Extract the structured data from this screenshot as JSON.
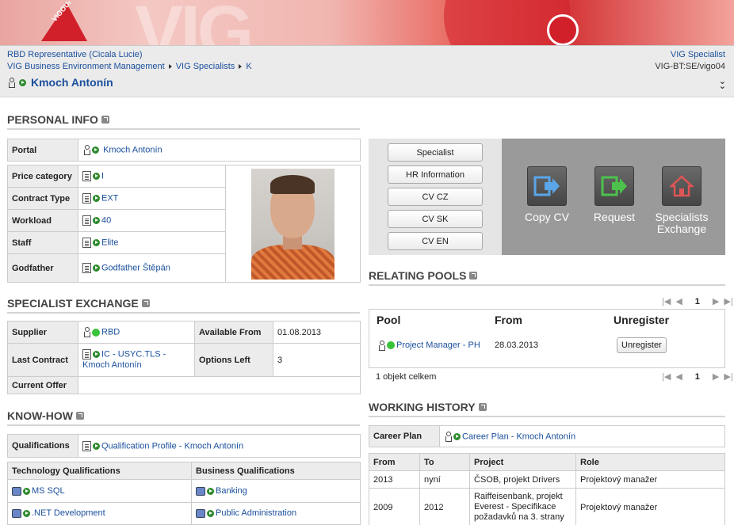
{
  "banner": {
    "logo_text": "VIGOUR",
    "ghost_text": "VIG"
  },
  "header": {
    "user": "RBD Representative (Cicala Lucie)",
    "breadcrumb": [
      "VIG Business Environment Management",
      "VIG Specialists",
      "K"
    ],
    "right_link": "VIG Specialist",
    "right_code": "VIG-BT:SE/vigo04",
    "title": "Kmoch Antonín"
  },
  "personal_info": {
    "title": "PERSONAL INFO",
    "portal_label": "Portal",
    "portal_value": "Kmoch Antonín",
    "rows": [
      {
        "label": "Price category",
        "value": "I"
      },
      {
        "label": "Contract Type",
        "value": "EXT"
      },
      {
        "label": "Workload",
        "value": "40"
      },
      {
        "label": "Staff",
        "value": "Elite"
      },
      {
        "label": "Godfather",
        "value": "Godfather Štěpán"
      }
    ]
  },
  "actions": {
    "buttons": [
      "Specialist",
      "HR Information",
      "CV CZ",
      "CV SK",
      "CV EN"
    ],
    "tiles": [
      "Copy CV",
      "Request",
      "Specialists Exchange"
    ]
  },
  "specialist_exchange": {
    "title": "SPECIALIST EXCHANGE",
    "supplier_label": "Supplier",
    "supplier_value": "RBD",
    "available_label": "Available From",
    "available_value": "01.08.2013",
    "last_contract_label": "Last Contract",
    "last_contract_value": "IC - USYC.TLS - Kmoch Antonín",
    "options_label": "Options Left",
    "options_value": "3",
    "current_offer_label": "Current Offer"
  },
  "relating_pools": {
    "title": "RELATING POOLS",
    "page": "1",
    "columns": [
      "Pool",
      "From",
      "Unregister"
    ],
    "row": {
      "pool": "Project Manager - PH",
      "from": "28.03.2013",
      "action": "Unregister"
    },
    "count_text": "1 objekt celkem"
  },
  "know_how": {
    "title": "KNOW-HOW",
    "qual_label": "Qualifications",
    "qual_value": "Qualification Profile - Kmoch Antonín",
    "tech_header": "Technology Qualifications",
    "biz_header": "Business Qualifications",
    "tech": [
      "MS SQL",
      ".NET Development"
    ],
    "biz": [
      "Banking",
      "Public Administration"
    ]
  },
  "working_history": {
    "title": "WORKING HISTORY",
    "career_label": "Career Plan",
    "career_value": "Career Plan - Kmoch Antonín",
    "columns": [
      "From",
      "To",
      "Project",
      "Role"
    ],
    "rows": [
      {
        "from": "2013",
        "to": "nyní",
        "project": "ČSOB, projekt Drivers",
        "role": "Projektový manažer"
      },
      {
        "from": "2009",
        "to": "2012",
        "project": "Raiffeisenbank, projekt Everest - Specifikace požadavků na 3. strany",
        "role": "Projektový manažer"
      }
    ]
  },
  "colors": {
    "link": "#1a4f9c",
    "label_bg": "#ececec",
    "panel_dark": "#9a9a9a",
    "banner_red": "#d1202a"
  }
}
